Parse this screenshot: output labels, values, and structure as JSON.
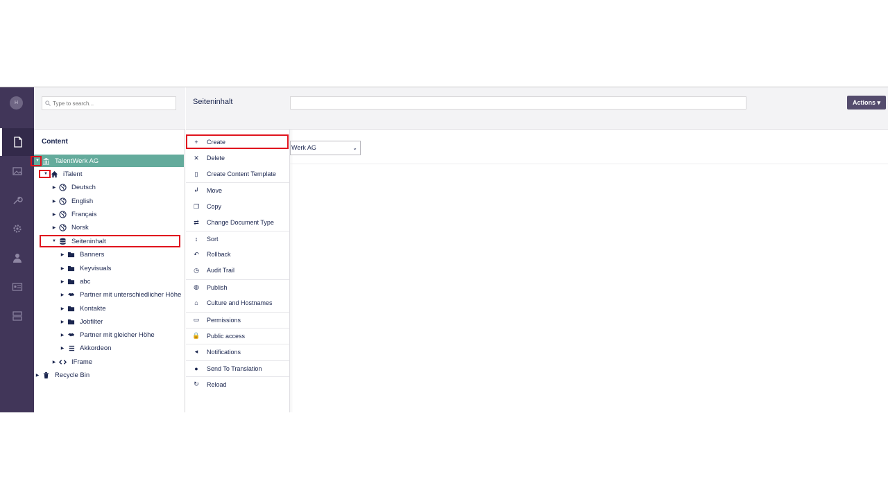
{
  "user": {
    "initials": "H"
  },
  "sections": [
    "content-icon",
    "media-icon",
    "settings-wrench-icon",
    "gear-icon",
    "user-icon",
    "members-card-icon",
    "forms-icon"
  ],
  "tree": {
    "search_placeholder": "Type to search...",
    "title": "Content",
    "nodes": [
      {
        "label": "TalentWerk AG",
        "icon": "bank-icon"
      },
      {
        "label": "iTalent",
        "icon": "home-icon"
      },
      {
        "label": "Deutsch",
        "icon": "globe-icon"
      },
      {
        "label": "English",
        "icon": "globe-icon"
      },
      {
        "label": "Français",
        "icon": "globe-icon"
      },
      {
        "label": "Norsk",
        "icon": "globe-icon"
      },
      {
        "label": "Seiteninhalt",
        "icon": "database-icon"
      },
      {
        "label": "Banners",
        "icon": "folder-icon"
      },
      {
        "label": "Keyvisuals",
        "icon": "folder-icon"
      },
      {
        "label": "abc",
        "icon": "folder-icon"
      },
      {
        "label": "Partner mit unterschiedlicher Höhe",
        "icon": "handshake-icon"
      },
      {
        "label": "Kontakte",
        "icon": "folder-icon"
      },
      {
        "label": "Jobfilter",
        "icon": "folder-icon"
      },
      {
        "label": "Partner mit gleicher Höhe",
        "icon": "handshake-icon"
      },
      {
        "label": "Akkordeon",
        "icon": "list-icon"
      },
      {
        "label": "IFrame",
        "icon": "code-icon"
      },
      {
        "label": "Recycle Bin",
        "icon": "trash-icon"
      }
    ]
  },
  "menu": {
    "title": "Seiteninhalt",
    "items": [
      {
        "label": "Create",
        "icon": "+"
      },
      {
        "label": "Delete",
        "icon": "✕"
      },
      {
        "label": "Create Content Template",
        "icon": "▯"
      },
      {
        "label": "Move",
        "icon": "↲"
      },
      {
        "label": "Copy",
        "icon": "❐"
      },
      {
        "label": "Change Document Type",
        "icon": "⇄"
      },
      {
        "label": "Sort",
        "icon": "↕"
      },
      {
        "label": "Rollback",
        "icon": "↶"
      },
      {
        "label": "Audit Trail",
        "icon": "◷"
      },
      {
        "label": "Publish",
        "icon": "◍"
      },
      {
        "label": "Culture and Hostnames",
        "icon": "⌂"
      },
      {
        "label": "Permissions",
        "icon": "▭"
      },
      {
        "label": "Public access",
        "icon": "🔒"
      },
      {
        "label": "Notifications",
        "icon": "◂"
      },
      {
        "label": "Send To Translation",
        "icon": "●"
      },
      {
        "label": "Reload",
        "icon": "↻"
      }
    ]
  },
  "main": {
    "actions_label": "Actions ▾",
    "culture_select_value": "Werk AG"
  },
  "colors": {
    "section_bar": "#413659",
    "selected": "#64ab9c",
    "highlight": "#e0141e",
    "actions": "#544c6d"
  }
}
